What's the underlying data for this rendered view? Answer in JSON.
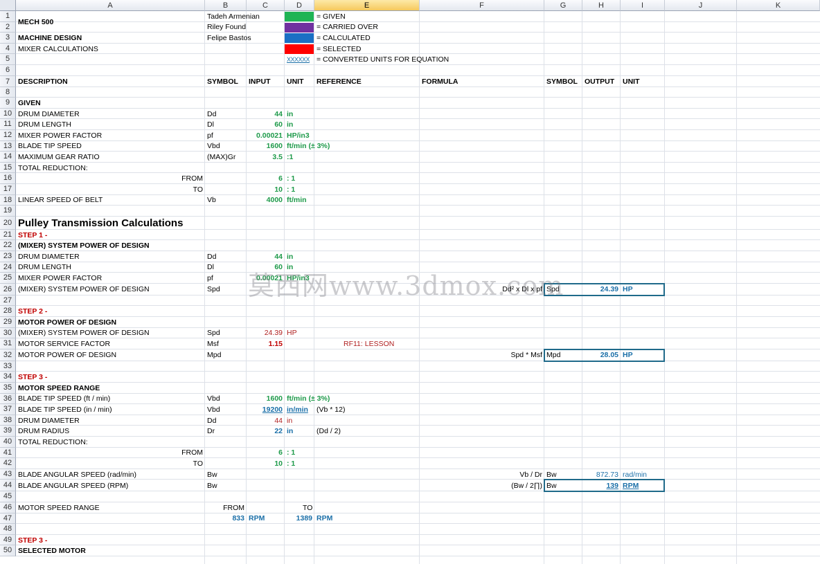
{
  "column_headers": [
    "A",
    "B",
    "C",
    "D",
    "E",
    "F",
    "G",
    "H",
    "I",
    "J",
    "K"
  ],
  "row_numbers": [
    "1",
    "2",
    "3",
    "4",
    "5",
    "6",
    "7",
    "8",
    "9",
    "10",
    "11",
    "12",
    "13",
    "14",
    "15",
    "16",
    "17",
    "18",
    "19",
    "20",
    "21",
    "22",
    "23",
    "24",
    "25",
    "26",
    "27",
    "28",
    "29",
    "30",
    "31",
    "32",
    "33",
    "34",
    "35",
    "36",
    "37",
    "38",
    "39",
    "40",
    "41",
    "42",
    "43",
    "44",
    "45",
    "46",
    "47",
    "48",
    "49",
    "50"
  ],
  "colors": {
    "given": "#1fb454",
    "carried_over": "#7030a0",
    "calculated": "#1a6fc4",
    "selected": "#ff0000",
    "green_text": "#1e9a4a",
    "blue_text": "#1a6fa8",
    "red_text": "#c00000"
  },
  "header": {
    "course": "MECH 500",
    "subject": "MACHINE DESIGN",
    "topic": "MIXER  CALCULATIONS",
    "author1": "Tadeh Armenian",
    "author2": "Riley Found",
    "author3": "Felipe Bastos"
  },
  "legend": {
    "given": "= GIVEN",
    "carried_over": "= CARRIED OVER",
    "calculated": "= CALCULATED",
    "selected": "= SELECTED",
    "converted_pattern": "XXXXXX",
    "converted": "= CONVERTED UNITS FOR EQUATION"
  },
  "table_headers": {
    "description": "DESCRIPTION",
    "symbol": "SYMBOL",
    "input": "INPUT",
    "unit": "UNIT",
    "reference": "REFERENCE",
    "formula": "FORMULA",
    "out_symbol": "SYMBOL",
    "output": "OUTPUT",
    "out_unit": "UNIT"
  },
  "given": {
    "title": "GIVEN",
    "r10": {
      "desc": "DRUM DIAMETER",
      "sym": "Dd",
      "val": "44",
      "unit": "in"
    },
    "r11": {
      "desc": "DRUM LENGTH",
      "sym": "Dl",
      "val": "60",
      "unit": "in"
    },
    "r12": {
      "desc": "MIXER POWER FACTOR",
      "sym": "pf",
      "val": "0.00021",
      "unit": "HP/in3"
    },
    "r13": {
      "desc": "BLADE TIP SPEED",
      "sym": "Vbd",
      "val": "1600",
      "unit": "ft/min (± 3%)"
    },
    "r14": {
      "desc": "MAXIMUM GEAR RATIO",
      "sym": "(MAX)Gr",
      "val": "3.5",
      "unit": ":1"
    },
    "r15": {
      "desc": "TOTAL REDUCTION:"
    },
    "r16": {
      "label": "FROM",
      "val": "6",
      "unit": ": 1"
    },
    "r17": {
      "label": "TO",
      "val": "10",
      "unit": ": 1"
    },
    "r18": {
      "desc": "LINEAR SPEED OF BELT",
      "sym": "Vb",
      "val": "4000",
      "unit": "ft/min"
    }
  },
  "section_title": "Pulley Transmission Calculations",
  "step1": {
    "label": "STEP 1 -",
    "title": "(MIXER) SYSTEM POWER OF DESIGN",
    "r23": {
      "desc": "DRUM DIAMETER",
      "sym": "Dd",
      "val": "44",
      "unit": "in"
    },
    "r24": {
      "desc": "DRUM LENGTH",
      "sym": "Dl",
      "val": "60",
      "unit": "in"
    },
    "r25": {
      "desc": "MIXER POWER FACTOR",
      "sym": "pf",
      "val": "0.00021",
      "unit": "HP/in3"
    },
    "r26": {
      "desc": "(MIXER) SYSTEM POWER OF DESIGN",
      "sym": "Spd",
      "formula": "Dd² x Dl x pf",
      "out_sym": "Spd",
      "out_val": "24.39",
      "out_unit": "HP"
    }
  },
  "step2": {
    "label": "STEP 2 -",
    "title": "MOTOR POWER OF DESIGN",
    "r30": {
      "desc": "(MIXER) SYSTEM POWER OF DESIGN",
      "sym": "Spd",
      "val": "24.39",
      "unit": "HP"
    },
    "r31": {
      "desc": "MOTOR SERVICE FACTOR",
      "sym": "Msf",
      "val": "1.15",
      "ref": "RF11: LESSON"
    },
    "r32": {
      "desc": "MOTOR POWER OF DESIGN",
      "sym": "Mpd",
      "formula": "Spd * Msf",
      "out_sym": "Mpd",
      "out_val": "28.05",
      "out_unit": "HP"
    }
  },
  "step3": {
    "label": "STEP 3 -",
    "title": "MOTOR SPEED RANGE",
    "r36": {
      "desc": "BLADE TIP SPEED (ft / min)",
      "sym": "Vbd",
      "val": "1600",
      "unit": "ft/min (± 3%)"
    },
    "r37": {
      "desc": "BLADE TIP SPEED (in / min)",
      "sym": "Vbd",
      "val": "19200",
      "unit": "in/min",
      "ref": "(Vb * 12)"
    },
    "r38": {
      "desc": "DRUM DIAMETER",
      "sym": "Dd",
      "val": "44",
      "unit": "in"
    },
    "r39": {
      "desc": "DRUM RADIUS",
      "sym": "Dr",
      "val": "22",
      "unit": "in",
      "ref": "(Dd / 2)"
    },
    "r40": {
      "desc": "TOTAL REDUCTION:"
    },
    "r41": {
      "label": "FROM",
      "val": "6",
      "unit": ": 1"
    },
    "r42": {
      "label": "TO",
      "val": "10",
      "unit": ": 1"
    },
    "r43": {
      "desc": "BLADE ANGULAR SPEED (rad/min)",
      "sym": "Bw",
      "formula": "Vb / Dr",
      "out_sym": "Bw",
      "out_val": "872.73",
      "out_unit": "rad/min"
    },
    "r44": {
      "desc": "BLADE ANGULAR SPEED (RPM)",
      "sym": "Bw",
      "formula": "(Bw / 2∏)",
      "out_sym": "Bw",
      "out_val": "139",
      "out_unit": "RPM"
    },
    "r46": {
      "desc": "MOTOR SPEED RANGE",
      "from": "FROM",
      "to": "TO"
    },
    "r47": {
      "from_val": "833",
      "from_unit": "RPM",
      "to_val": "1389",
      "to_unit": "RPM"
    }
  },
  "step3b": {
    "label": "STEP 3 -",
    "title": "SELECTED MOTOR"
  },
  "watermark": "莫西网www.3dmox.com"
}
